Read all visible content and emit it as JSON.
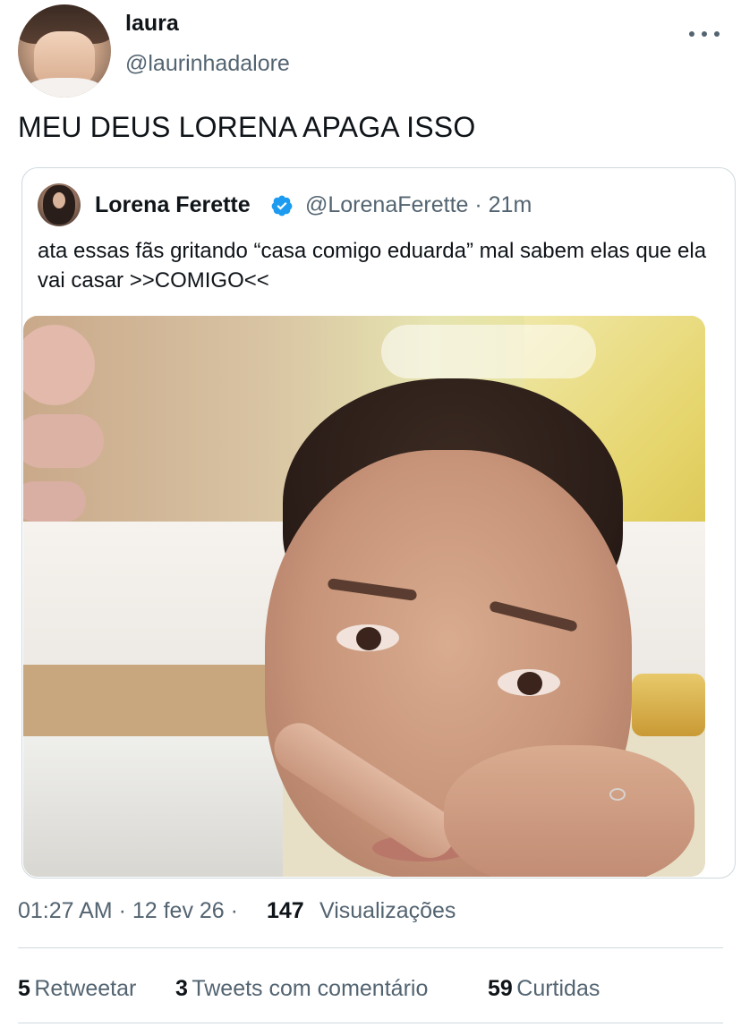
{
  "author": {
    "name": "laura",
    "handle": "@laurinhadalore"
  },
  "tweet": {
    "text": "MEU DEUS LORENA APAGA ISSO"
  },
  "quoted": {
    "name": "Lorena Ferette",
    "handle_time": "@LorenaFerette · 21m",
    "text": "ata essas fãs gritando “casa comigo eduarda” mal sabem elas que ela vai casar >>COMIGO<<"
  },
  "meta": {
    "time_date": "01:27 AM · 12 fev 26 ·",
    "views_count": "147",
    "views_label": "Visualizações"
  },
  "stats": {
    "retweets_count": "5",
    "retweets_label": "Retweetar",
    "quotes_count": "3",
    "quotes_label": "Tweets com comentário",
    "likes_count": "59",
    "likes_label": "Curtidas"
  },
  "colors": {
    "verified": "#1d9bf0",
    "secondary_text": "#536471",
    "border": "#cfd9de"
  },
  "icons": {
    "more": "more-icon",
    "verified": "verified-badge-icon"
  }
}
